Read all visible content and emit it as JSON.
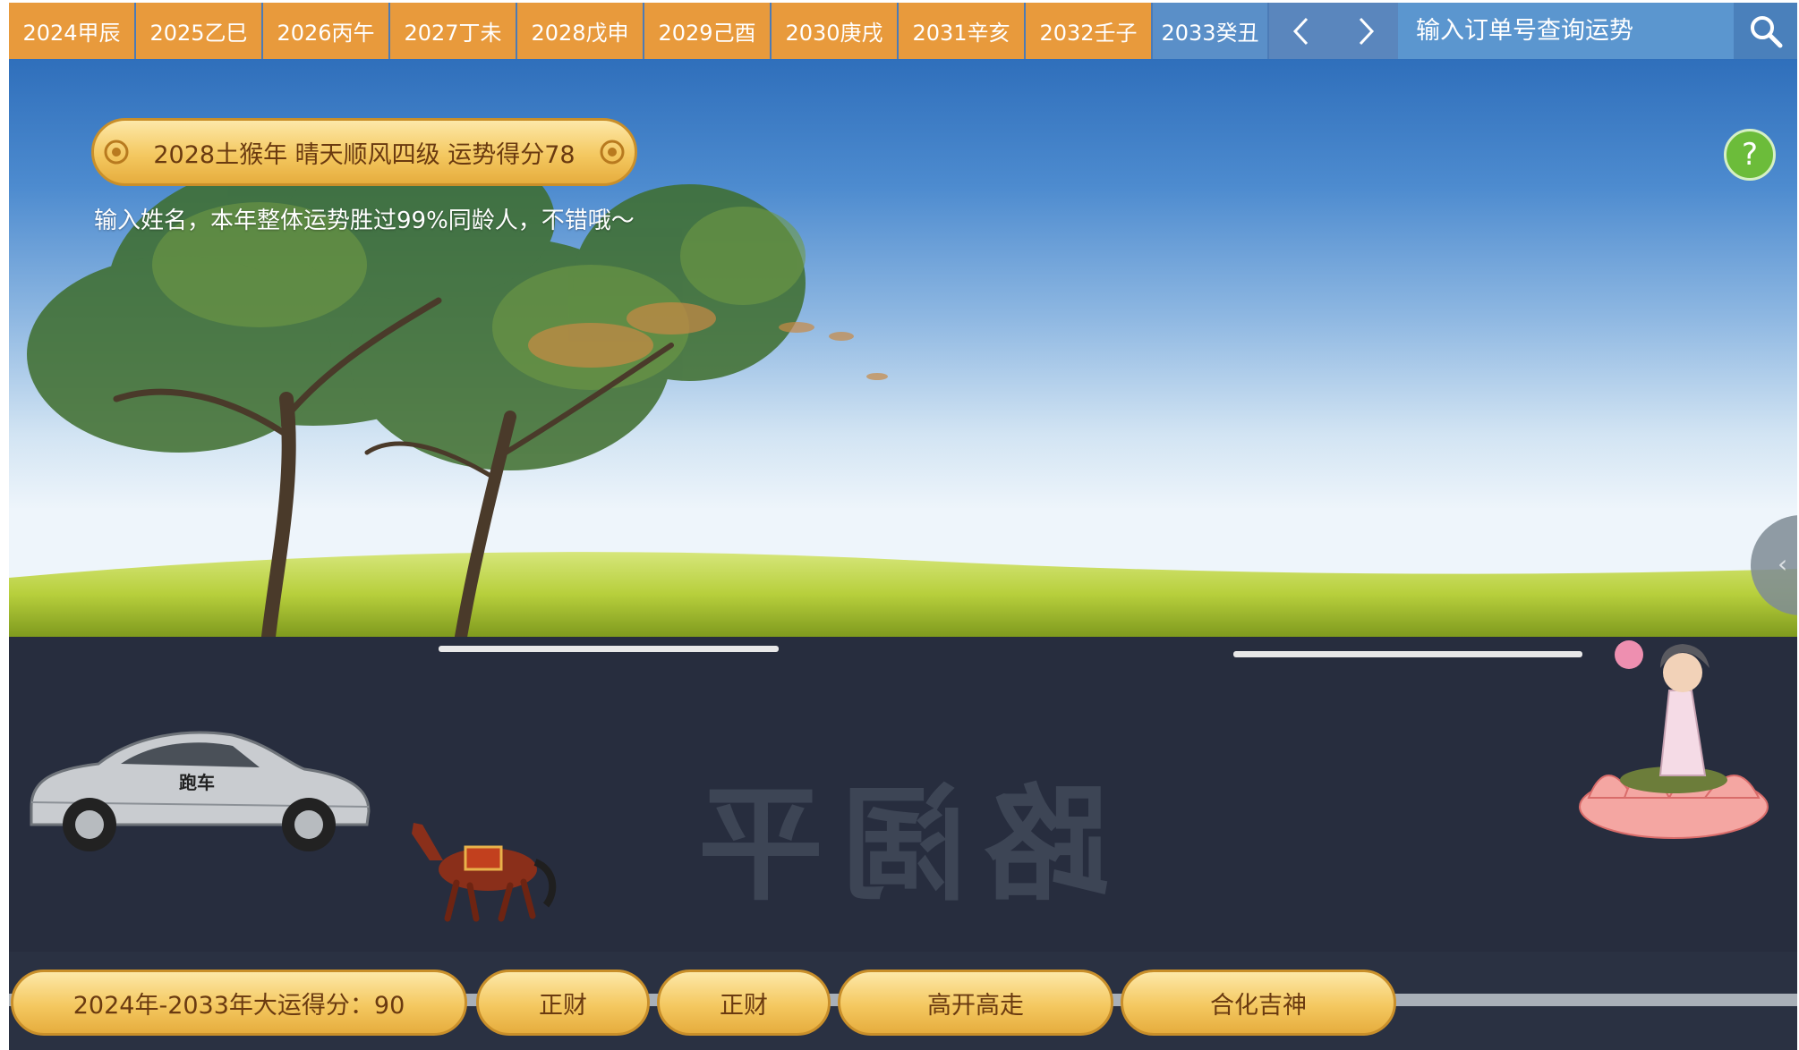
{
  "topbar": {
    "years": [
      {
        "label": "2024甲辰",
        "active": false
      },
      {
        "label": "2025乙巳",
        "active": false
      },
      {
        "label": "2026丙午",
        "active": false
      },
      {
        "label": "2027丁未",
        "active": false
      },
      {
        "label": "2028戊申",
        "active": false
      },
      {
        "label": "2029己酉",
        "active": false
      },
      {
        "label": "2030庚戌",
        "active": false
      },
      {
        "label": "2031辛亥",
        "active": false
      },
      {
        "label": "2032壬子",
        "active": false
      },
      {
        "label": "2033癸丑",
        "active": true
      }
    ],
    "prev_label": "‹",
    "next_label": "›",
    "search_placeholder": "输入订单号查询运势"
  },
  "scene": {
    "title": "2028土猴年 晴天顺风四级 运势得分78",
    "subtitle": "输入姓名，本年整体运势胜过99%同龄人，不错哦～",
    "help_label": "?",
    "side_tab_label": "‹",
    "road_text": "路阔平",
    "car_label": "跑车"
  },
  "bottombar": {
    "summary": "2024年-2033年大运得分：90",
    "tags": [
      "正财",
      "正财",
      "高开高走",
      "合化吉神"
    ]
  },
  "colors": {
    "tab_orange": "#e89a3c",
    "tab_active_blue": "#5a8fc8",
    "plaque_gold": "#f4c860",
    "road_dark": "#272d3e",
    "help_green": "#6cbc3a"
  }
}
